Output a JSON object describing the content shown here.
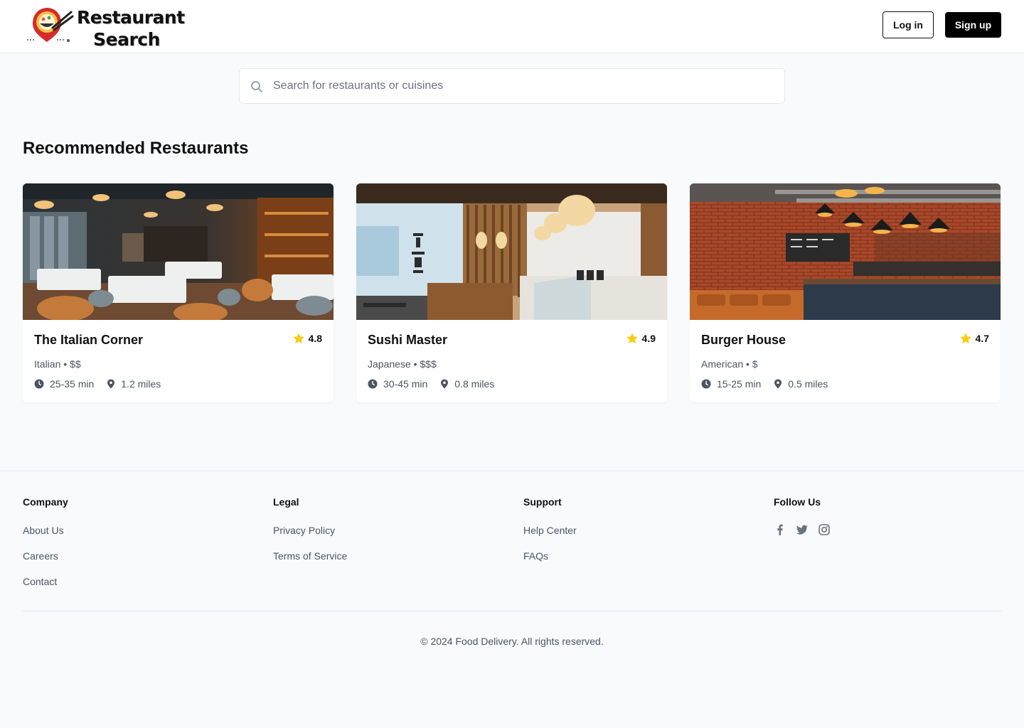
{
  "header": {
    "logo_line1": "Restaurant",
    "logo_line2": "Search",
    "login_label": "Log in",
    "signup_label": "Sign up"
  },
  "search": {
    "placeholder": "Search for restaurants or cuisines",
    "value": ""
  },
  "main": {
    "section_title": "Recommended Restaurants",
    "restaurants": [
      {
        "name": "The Italian Corner",
        "rating": "4.8",
        "meta": "Italian • $$",
        "time": "25-35 min",
        "distance": "1.2 miles"
      },
      {
        "name": "Sushi Master",
        "rating": "4.9",
        "meta": "Japanese • $$$",
        "time": "30-45 min",
        "distance": "0.8 miles"
      },
      {
        "name": "Burger House",
        "rating": "4.7",
        "meta": "American • $",
        "time": "15-25 min",
        "distance": "0.5 miles"
      }
    ]
  },
  "footer": {
    "columns": [
      {
        "heading": "Company",
        "links": [
          "About Us",
          "Careers",
          "Contact"
        ]
      },
      {
        "heading": "Legal",
        "links": [
          "Privacy Policy",
          "Terms of Service"
        ]
      },
      {
        "heading": "Support",
        "links": [
          "Help Center",
          "FAQs"
        ]
      },
      {
        "heading": "Follow Us",
        "icons": [
          "facebook-icon",
          "twitter-icon",
          "instagram-icon"
        ]
      }
    ],
    "copyright": "© 2024 Food Delivery. All rights reserved."
  },
  "colors": {
    "page_bg": "#f9fafb",
    "primary": "#000000",
    "star": "#facc15",
    "muted_text": "#4b5563"
  }
}
